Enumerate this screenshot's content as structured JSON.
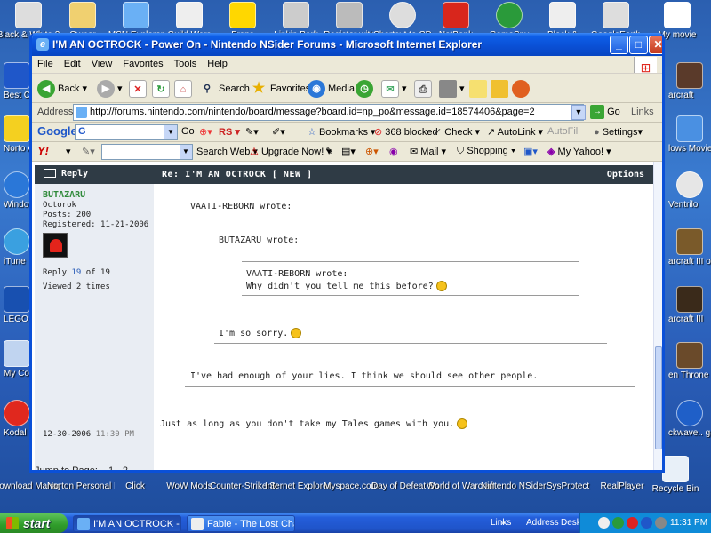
{
  "desktop": {
    "top_icons": [
      "Black & White 2",
      "Owner",
      "MSN Explorer",
      "Guild Wars",
      "Fraps",
      "Linkin Park",
      "Register with",
      "Shortcut to CD",
      "NetBank",
      "GameSpy",
      "Black &",
      "GoogleEarth",
      "My movie"
    ],
    "left_icons": [
      "Best Ca Quicken",
      "Norto AntiVirus",
      "Windows Playe",
      "iTune",
      "LEGO F Raider",
      "My Com",
      "Kodal EasySh"
    ],
    "right_icons": [
      "arcraft",
      "lows Movie Maker",
      "Ventrilo",
      "arcraft III orld Editor",
      "arcraft III",
      "en Throne",
      "ckwave.. games",
      "Recycle Bin"
    ],
    "bottom_icons": [
      "Download Manager",
      "Norton Personal Fir...",
      "Click",
      "WoW Mods",
      "Counter-Strike Source",
      "Internet Explorer",
      "Myspace.com",
      "Day of Defeat Source",
      "World of Warcraft",
      "Nintendo NSider Forums",
      "SysProtect",
      "RealPlayer"
    ]
  },
  "window": {
    "title": "I'M AN OCTROCK - Power On - Nintendo NSider Forums - Microsoft Internet Explorer",
    "buttons": {
      "minimize": "_",
      "maximize": "□",
      "close": "✕"
    }
  },
  "menubar": [
    "File",
    "Edit",
    "View",
    "Favorites",
    "Tools",
    "Help"
  ],
  "toolbar": {
    "back": "Back",
    "search": "Search",
    "favorites": "Favorites",
    "media": "Media"
  },
  "address": {
    "label": "Address",
    "url": "http://forums.nintendo.com/nintendo/board/message?board.id=np_po&message.id=18574406&page=2",
    "go": "Go",
    "links": "Links"
  },
  "googlebar": {
    "logo": "Google",
    "input_prefix": "G",
    "go": "Go",
    "rs": "RS",
    "bookmarks": "Bookmarks",
    "blocked": "368 blocked",
    "check": "Check",
    "autolink": "AutoLink",
    "autofill": "AutoFill",
    "settings": "Settings"
  },
  "yahoobar": {
    "logo": "Y!",
    "search_web": "Search Web",
    "upgrade": "Upgrade Now!",
    "mail": "Mail",
    "shopping": "Shopping",
    "myyahoo": "My Yahoo!"
  },
  "forum": {
    "reply_label": "Reply",
    "subject": "Re: I'M AN OCTROCK  [ NEW ]",
    "options_label": "Options",
    "author": {
      "name": "BUTAZARU",
      "rank": "Octorok",
      "posts": "Posts: 200",
      "registered": "Registered: 11-21-2006"
    },
    "reply_prefix": "Reply ",
    "reply_num": "19",
    "reply_suffix": " of 19",
    "viewed": "Viewed 2 times",
    "date": "12-30-2006",
    "time": "11:30 PM",
    "quotes": {
      "outer_header": "VAATI-REBORN wrote:",
      "middle_header": "BUTAZARU wrote:",
      "inner_header": "VAATI-REBORN wrote:",
      "inner_text": "Why didn't you tell me this before?",
      "middle_text": "I'm so sorry.",
      "outer_text": "I've had enough of your lies. I think we should see other people."
    },
    "reply_text": "Just as long as you don't take my Tales games with you.",
    "jump_label": "Jump to Page:",
    "pages": [
      "1",
      "2"
    ]
  },
  "taskbar": {
    "start": "start",
    "tasks": [
      "I'M AN OCTROCK - P...",
      "Fable - The Lost Cha..."
    ],
    "tray": {
      "links": "Links",
      "address": "Address",
      "desktop": "Desktop",
      "clock": "11:31 PM"
    }
  }
}
